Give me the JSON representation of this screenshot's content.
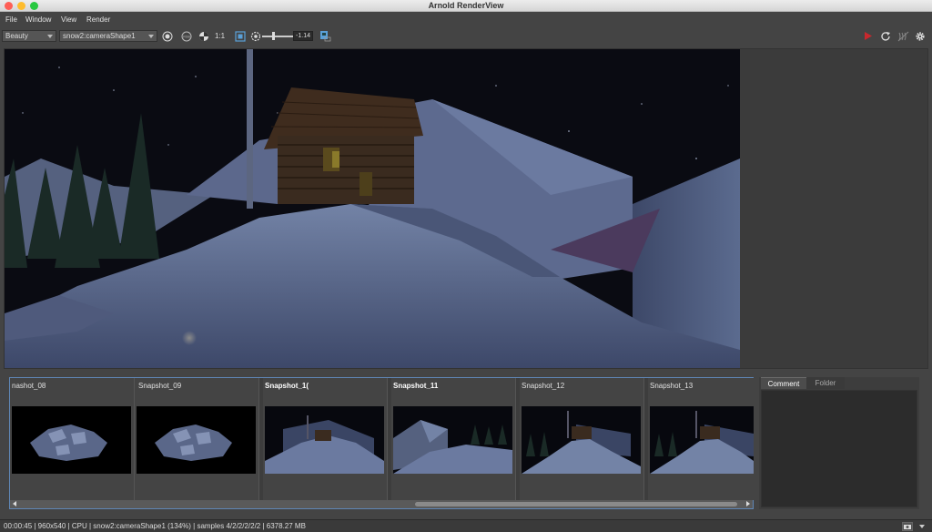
{
  "window": {
    "title": "Arnold RenderView"
  },
  "menu": [
    "File",
    "Window",
    "View",
    "Render"
  ],
  "toolbar": {
    "aov": "Beauty",
    "camera": "snow2:cameraShape1",
    "zoom_label": "1:1",
    "exposure": "-1.14",
    "icons": [
      "crop-region-icon",
      "ipr-eye-icon",
      "color-channel-icon",
      "fit-frame-icon",
      "color-correct-icon",
      "snapshot-icon",
      "render-play-icon",
      "refresh-icon",
      "debug-shading-icon",
      "settings-gear-icon"
    ],
    "colors": {
      "render_play": "#c8282d"
    }
  },
  "snapshots": [
    {
      "label": "nashot_08",
      "bold": false,
      "scene": "rocks"
    },
    {
      "label": "Snapshot_09",
      "bold": false,
      "scene": "rocks"
    },
    {
      "label": "Snapshot_1(",
      "bold": true,
      "scene": "cabin-far"
    },
    {
      "label": "Snapshot_11",
      "bold": true,
      "scene": "ice"
    },
    {
      "label": "Snapshot_12",
      "bold": false,
      "scene": "cabin-hill"
    },
    {
      "label": "Snapshot_13",
      "bold": false,
      "scene": "cabin-hill"
    }
  ],
  "side_tabs": [
    "Comment",
    "Folder"
  ],
  "status": {
    "text": "00:00:45 | 960x540 | CPU | snow2:cameraShape1 (134%) | samples 4/2/2/2/2/2 | 6378.27 MB"
  }
}
